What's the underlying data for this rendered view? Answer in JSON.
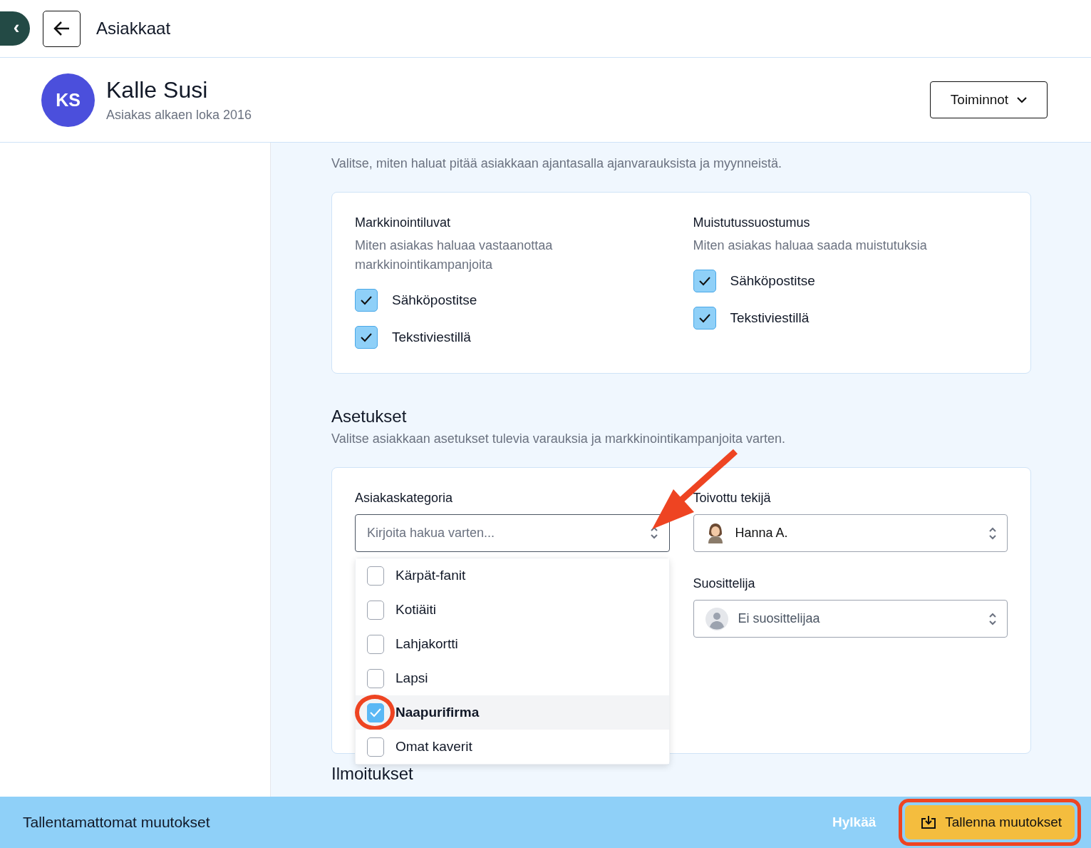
{
  "topbar": {
    "collapse_glyph": "‹",
    "title": "Asiakkaat"
  },
  "customer": {
    "initials": "KS",
    "name": "Kalle Susi",
    "since": "Asiakas alkaen loka 2016",
    "actions_button": "Toiminnot"
  },
  "notifications_intro": "Valitse, miten haluat pitää asiakkaan ajantasalla ajanvarauksista ja myynneistä.",
  "consents": [
    {
      "title": "Markkinointiluvat",
      "description": "Miten asiakas haluaa vastaanottaa markkinointikampanjoita",
      "options": [
        {
          "label": "Sähköpostitse",
          "checked": true
        },
        {
          "label": "Tekstiviestillä",
          "checked": true
        }
      ]
    },
    {
      "title": "Muistutussuostumus",
      "description": "Miten asiakas haluaa saada muistutuksia",
      "options": [
        {
          "label": "Sähköpostitse",
          "checked": true
        },
        {
          "label": "Tekstiviestillä",
          "checked": true
        }
      ]
    }
  ],
  "settings": {
    "title": "Asetukset",
    "description": "Valitse asiakkaan asetukset tulevia varauksia ja markkinointikampanjoita varten.",
    "category": {
      "label": "Asiakaskategoria",
      "placeholder": "Kirjoita hakua varten...",
      "expanded": true,
      "options": [
        {
          "label": "Kärpät-fanit",
          "checked": false,
          "selected": false,
          "highlighted": false
        },
        {
          "label": "Kotiäiti",
          "checked": false,
          "selected": false,
          "highlighted": false
        },
        {
          "label": "Lahjakortti",
          "checked": false,
          "selected": false,
          "highlighted": false
        },
        {
          "label": "Lapsi",
          "checked": false,
          "selected": false,
          "highlighted": false
        },
        {
          "label": "Naapurifirma",
          "checked": true,
          "selected": true,
          "highlighted": true
        },
        {
          "label": "Omat kaverit",
          "checked": false,
          "selected": false,
          "highlighted": false
        }
      ]
    },
    "preferred_staff": {
      "label": "Toivottu tekijä",
      "value": "Hanna A."
    },
    "referrer": {
      "label": "Suosittelija",
      "value": "Ei suosittelijaa"
    }
  },
  "next_section_title": "Ilmoitukset",
  "annotations": {
    "arrow": true
  },
  "unsaved_bar": {
    "message": "Tallentamattomat muutokset",
    "discard": "Hylkää",
    "save": "Tallenna muutokset",
    "save_highlighted": true
  }
}
